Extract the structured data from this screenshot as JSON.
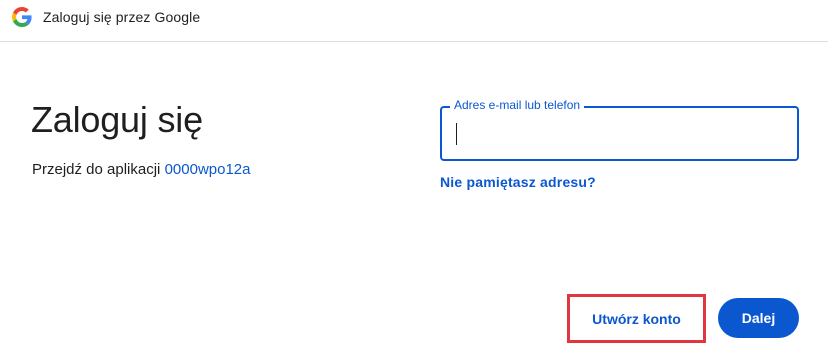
{
  "header": {
    "logo_icon": "google-g-icon",
    "title": "Zaloguj się przez Google"
  },
  "main": {
    "title": "Zaloguj się",
    "subtitle_prefix": "Przejdź do aplikacji",
    "app_name": "0000wpo12a"
  },
  "form": {
    "email_label": "Adres e-mail lub telefon",
    "email_value": "",
    "forgot_link": "Nie pamiętasz adresu?"
  },
  "actions": {
    "create_account_label": "Utwórz konto",
    "next_label": "Dalej"
  },
  "colors": {
    "accent": "#0b57d0",
    "highlight": "#e0373f",
    "text": "#1f1f1f",
    "divider": "#dadce0"
  }
}
